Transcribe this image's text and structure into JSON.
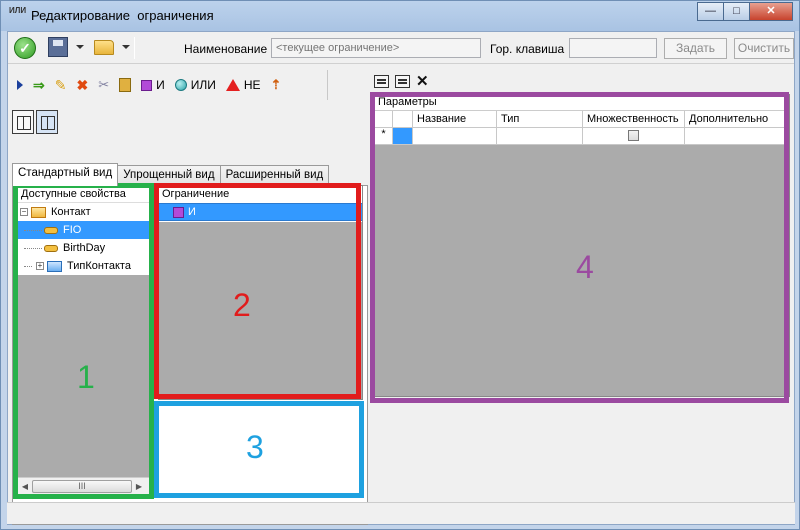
{
  "window": {
    "title": "Редактирование  ограничения",
    "icon_text": "ИЛИ",
    "buttons": {
      "minimize": "—",
      "maximize": "□",
      "close": "✕"
    }
  },
  "toolbar": {
    "name_label": "Наименование",
    "name_placeholder": "<текущее ограничение>",
    "hotkey_label": "Гор. клавиша",
    "hotkey_value": "",
    "set_button": "Задать",
    "clear_button": "Очистить"
  },
  "logic_toolbar": {
    "and_label": "И",
    "or_label": "ИЛИ",
    "not_label": "НЕ"
  },
  "tabs": [
    "Стандартный вид",
    "Упрощенный вид",
    "Расширенный вид"
  ],
  "properties_panel": {
    "header": "Доступные свойства",
    "tree": [
      {
        "label": "Контакт",
        "expander": "−"
      },
      {
        "label": "FIO"
      },
      {
        "label": "BirthDay"
      },
      {
        "label": "ТипКонтакта",
        "expander": "+"
      }
    ],
    "scroll_thumb": "III",
    "scroll_left": "◀",
    "scroll_right": "▶"
  },
  "restriction_panel": {
    "header": "Ограничение",
    "row_label": "И"
  },
  "params_panel": {
    "header": "Параметры",
    "columns": [
      "Название",
      "Тип",
      "Множественность",
      "Дополнительно"
    ],
    "new_row_marker": "*"
  },
  "annotations": {
    "colors": {
      "green": "#26b14a",
      "red": "#e11c1c",
      "blue": "#1ea1e0",
      "purple": "#9b4aa0"
    },
    "labels": [
      "1",
      "2",
      "3",
      "4"
    ]
  }
}
